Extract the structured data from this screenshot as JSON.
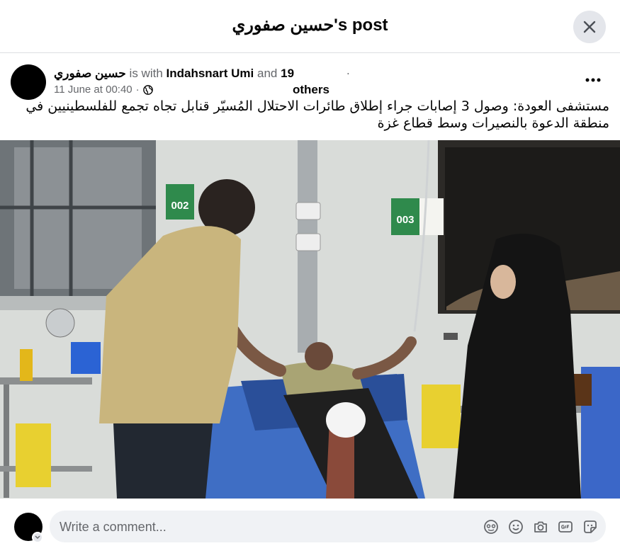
{
  "dialog": {
    "title": "حسين صفوري's post"
  },
  "post": {
    "author": "حسين صفوري",
    "with_text": "is with",
    "tagged_person": "Indahsnart Umi",
    "and_text": "and",
    "others_count": "19",
    "others_label": "others",
    "separator": ".",
    "timestamp": "11 June at 00:40",
    "meta_dot": "·",
    "privacy_icon": "globe-icon",
    "more_icon": "more-horizontal-icon",
    "text": "مستشفى العودة: وصول 3 إصابات جراء إطلاق طائرات الاحتلال المُسيّر قنابل تجاه تجمع للفلسطينيين في منطقة الدعوة بالنصيرات وسط قطاع غزة"
  },
  "photo": {
    "sign_left": "002",
    "sign_right": "003"
  },
  "comment": {
    "placeholder": "Write a comment...",
    "icons": [
      "avatar-sticker-icon",
      "emoji-icon",
      "camera-icon",
      "gif-icon",
      "sticker-icon"
    ]
  },
  "colors": {
    "secondary_text": "#65676b",
    "input_bg": "#f0f2f5",
    "button_bg": "#e4e6eb"
  }
}
